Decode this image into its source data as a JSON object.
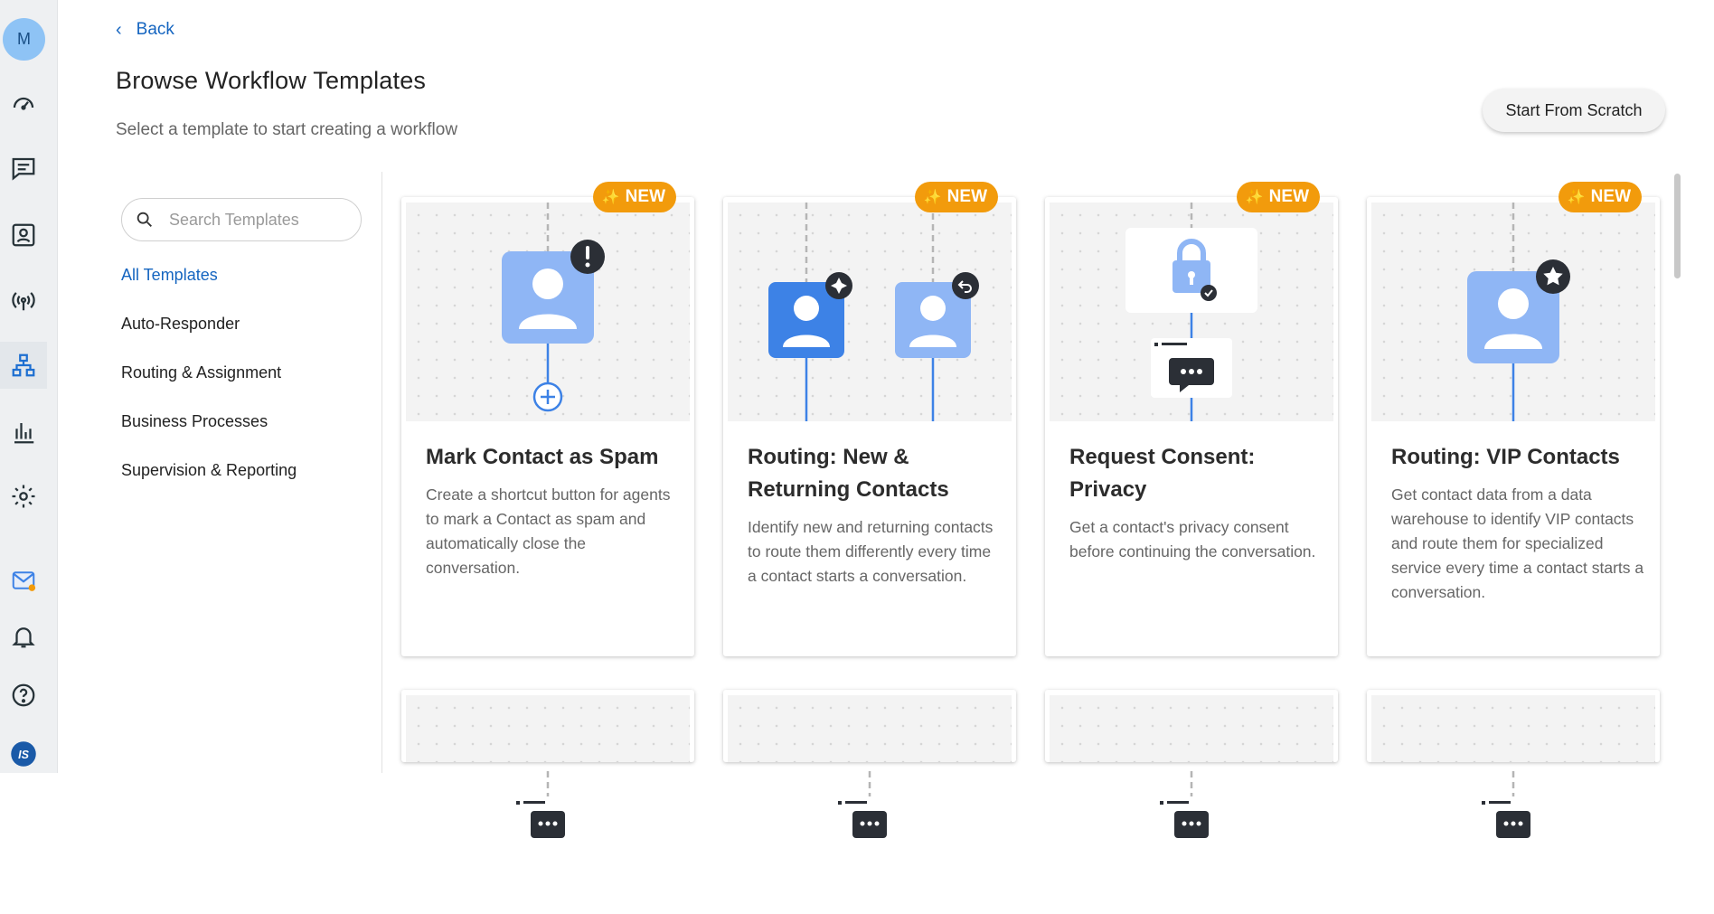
{
  "rail": {
    "avatar_initial": "M",
    "items": [
      {
        "name": "dashboard-icon"
      },
      {
        "name": "messages-icon"
      },
      {
        "name": "contacts-icon"
      },
      {
        "name": "broadcast-icon"
      },
      {
        "name": "workflows-icon",
        "active": true
      },
      {
        "name": "reports-icon"
      },
      {
        "name": "settings-icon"
      },
      {
        "name": "mail-icon"
      },
      {
        "name": "notifications-icon"
      },
      {
        "name": "help-icon"
      },
      {
        "name": "brand-logo-icon"
      }
    ]
  },
  "header": {
    "back_label": "Back",
    "title": "Browse Workflow Templates",
    "subtitle": "Select a template to start creating a workflow",
    "scratch_label": "Start From Scratch"
  },
  "filters": {
    "search_placeholder": "Search Templates",
    "categories": [
      {
        "label": "All Templates",
        "active": true
      },
      {
        "label": "Auto-Responder"
      },
      {
        "label": "Routing & Assignment"
      },
      {
        "label": "Business Processes"
      },
      {
        "label": "Supervision & Reporting"
      }
    ]
  },
  "templates": [
    {
      "badge": "NEW",
      "title": "Mark Contact as Spam",
      "description": "Create a shortcut button for agents to mark a Contact as spam and automatically close the conversation."
    },
    {
      "badge": "NEW",
      "title": "Routing: New & Returning Contacts",
      "description": "Identify new and returning contacts to route them differently every time a contact starts a conversation."
    },
    {
      "badge": "NEW",
      "title": "Request Consent: Privacy",
      "description": "Get a contact's privacy consent before continuing the conversation."
    },
    {
      "badge": "NEW",
      "title": "Routing: VIP Contacts",
      "description": "Get contact data from a data warehouse to identify VIP contacts and route them for specialized service every time a contact starts a conversation."
    }
  ],
  "colors": {
    "accent": "#1565c0",
    "badge": "#f29b0c",
    "person_light": "#8fb6f5",
    "person_dark": "#3d82e6"
  }
}
